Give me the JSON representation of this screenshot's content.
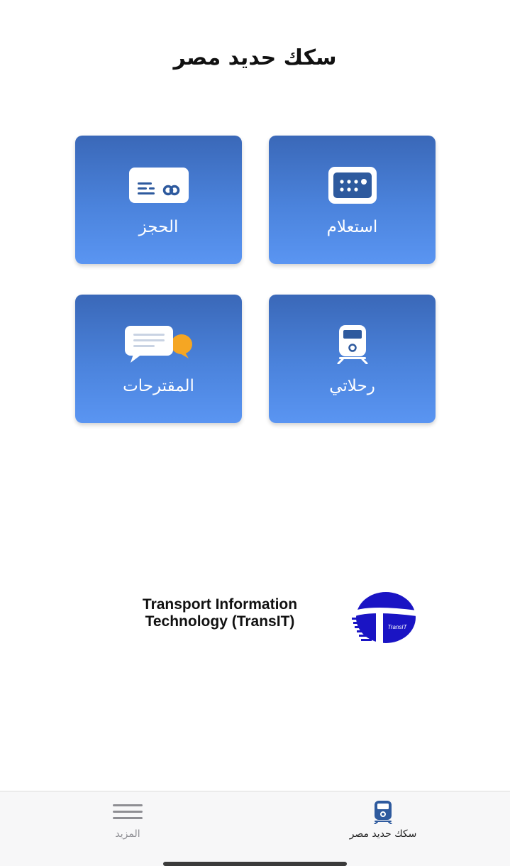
{
  "header": {
    "title": "سكك حديد مصر"
  },
  "tiles": [
    {
      "id": "inquiry",
      "label": "استعلام",
      "icon": "schedule-board-icon"
    },
    {
      "id": "booking",
      "label": "الحجز",
      "icon": "ticket-card-icon"
    },
    {
      "id": "trips",
      "label": "رحلاتي",
      "icon": "train-icon"
    },
    {
      "id": "suggestions",
      "label": "المقترحات",
      "icon": "chat-bubbles-icon"
    }
  ],
  "branding": {
    "line1": "Transport Information",
    "line2": "Technology (TransIT)",
    "logo_text": "TransIT",
    "logo_color": "#1a14c4"
  },
  "tab_bar": {
    "items": [
      {
        "id": "more",
        "label": "المزيد",
        "icon": "menu-icon",
        "active": false
      },
      {
        "id": "home",
        "label": "سكك حديد مصر",
        "icon": "train-icon",
        "active": true
      }
    ]
  },
  "colors": {
    "tile_top": "#3a68b8",
    "tile_bottom": "#5a95f2",
    "chat_accent": "#f5a623",
    "icon_dark_blue": "#2e5a9e"
  }
}
